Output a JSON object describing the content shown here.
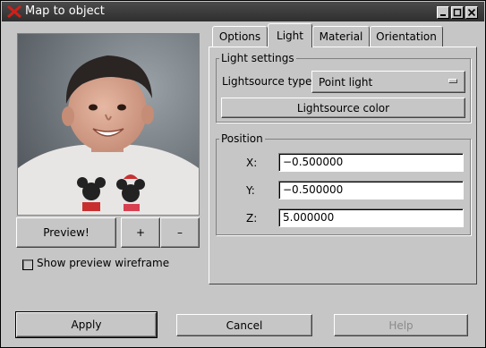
{
  "window": {
    "title": "Map to object"
  },
  "preview": {
    "preview_button": "Preview!",
    "zoom_in": "+",
    "zoom_out": "–",
    "wireframe_label": "Show preview wireframe"
  },
  "tabs": [
    {
      "label": "Options"
    },
    {
      "label": "Light"
    },
    {
      "label": "Material"
    },
    {
      "label": "Orientation"
    }
  ],
  "light_settings": {
    "group_label": "Light settings",
    "type_label": "Lightsource type:",
    "type_value": "Point light",
    "color_button": "Lightsource color"
  },
  "position": {
    "group_label": "Position",
    "x_label": "X:",
    "x_value": "−0.500000",
    "y_label": "Y:",
    "y_value": "−0.500000",
    "z_label": "Z:",
    "z_value": "5.000000"
  },
  "footer": {
    "apply": "Apply",
    "cancel": "Cancel",
    "help": "Help"
  }
}
